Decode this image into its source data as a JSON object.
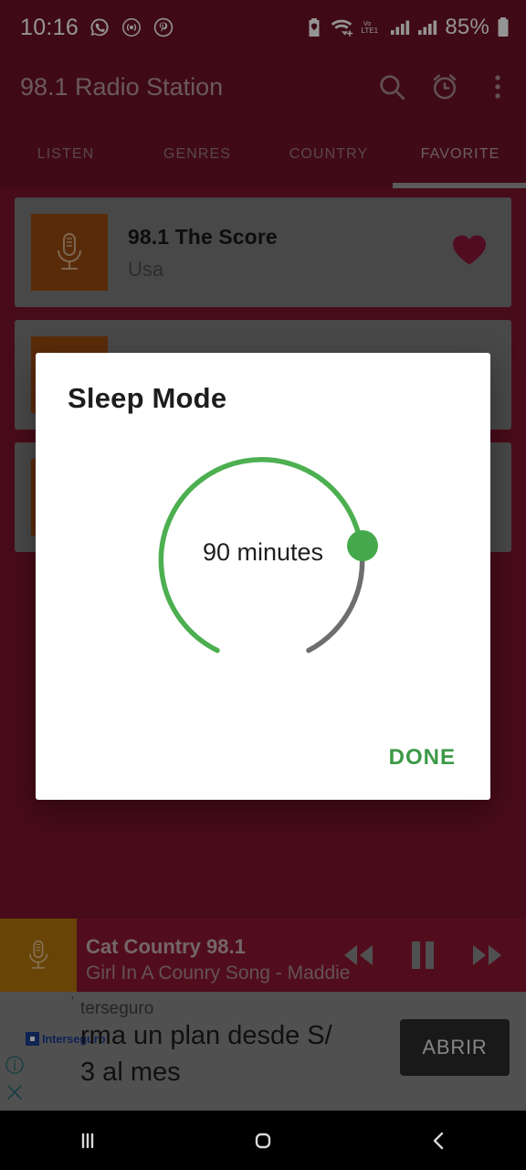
{
  "status_bar": {
    "time": "10:16",
    "left_icons": [
      "whatsapp-icon",
      "broadcast-icon",
      "pinterest-icon"
    ],
    "right_icons": [
      "battery-saver-icon",
      "wifi-icon",
      "volte-icon",
      "signal-1-icon",
      "signal-2-icon"
    ],
    "volte_label": "Vo LTE1",
    "battery": "85%"
  },
  "app_bar": {
    "title": "98.1 Radio Station",
    "actions": [
      "search-icon",
      "alarm-icon",
      "overflow-menu-icon"
    ]
  },
  "tabs": {
    "items": [
      {
        "label": "LISTEN",
        "active": false
      },
      {
        "label": "GENRES",
        "active": false
      },
      {
        "label": "COUNTRY",
        "active": false
      },
      {
        "label": "FAVORITE",
        "active": true
      }
    ]
  },
  "stations": [
    {
      "title": "98.1 The Score",
      "country": "Usa",
      "favorite": true,
      "icon": "microphone-icon"
    },
    {
      "title": "",
      "country": "",
      "favorite": false,
      "icon": "microphone-icon"
    },
    {
      "title": "",
      "country": "",
      "favorite": false,
      "icon": "microphone-icon"
    }
  ],
  "dialog": {
    "title": "Sleep Mode",
    "value_label": "90 minutes",
    "minutes": 90,
    "max_minutes": 120,
    "done_label": "DONE",
    "arc_active_color": "#4caf50",
    "arc_track_color": "#6e6e6e",
    "knob_color": "#46a84c"
  },
  "player": {
    "station": "Cat Country 98.1",
    "now_playing": "Girl In A Counry Song - Maddie..",
    "icon": "microphone-icon",
    "controls": [
      "rewind-icon",
      "pause-icon",
      "fast-forward-icon"
    ]
  },
  "ad": {
    "advertiser": "terseguro",
    "headline_line1": "rma un plan desde S/",
    "headline_line2": "3 al mes",
    "brand": "Interseguro",
    "cta_label": "ABRIR",
    "info_icon": "info-icon",
    "close_icon": "close-icon"
  },
  "nav_bar": {
    "recents_label": "recents-icon",
    "home_label": "home-icon",
    "back_label": "back-icon"
  },
  "colors": {
    "brand_maroon": "#7d132c",
    "app_bar": "#6d1227",
    "accent_green": "#4caf50",
    "thumbnail_orange": "#b4760c"
  }
}
